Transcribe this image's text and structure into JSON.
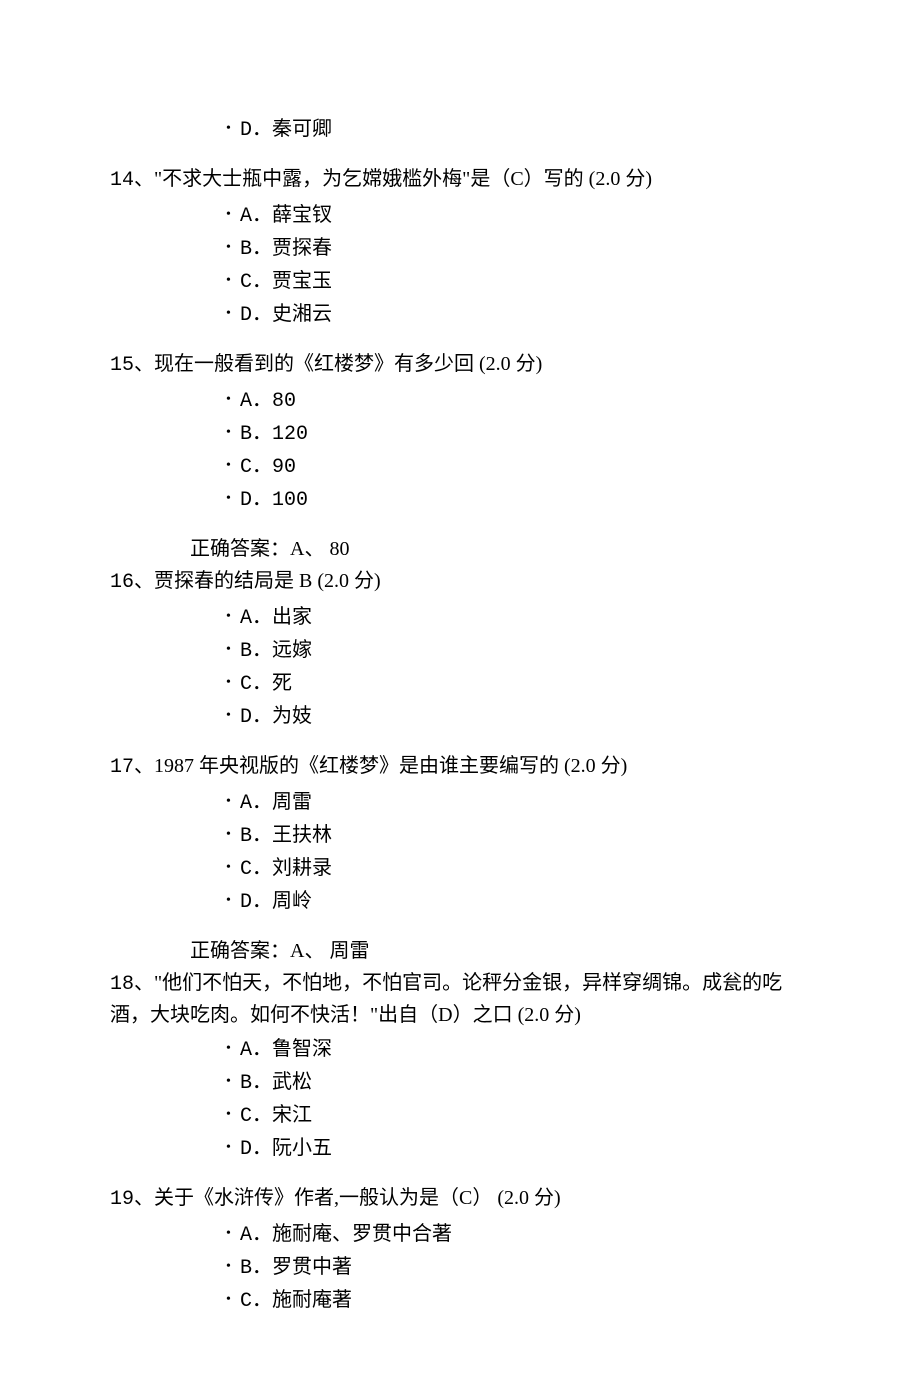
{
  "trailing_option": "D．秦可卿",
  "questions": [
    {
      "num": "14",
      "text": "、\"不求大士瓶中露，为乞嫦娥槛外梅\"是（C）写的   (2.0 分)",
      "options": [
        "A．薛宝钗",
        "B．贾探春",
        "C．贾宝玉",
        "D．史湘云"
      ],
      "answer": ""
    },
    {
      "num": "15",
      "text": "、现在一般看到的《红楼梦》有多少回   (2.0 分)",
      "options": [
        "A．80",
        "B．120",
        "C．90",
        "D．100"
      ],
      "answer": "正确答案：A、 80"
    },
    {
      "num": "16",
      "text": "、贾探春的结局是 B   (2.0 分)",
      "options": [
        "A．出家",
        "B．远嫁",
        "C．死",
        "D．为妓"
      ],
      "answer": ""
    },
    {
      "num": "17",
      "text": "、1987 年央视版的《红楼梦》是由谁主要编写的   (2.0 分)",
      "options": [
        "A．周雷",
        "B．王扶林",
        "C．刘耕录",
        "D．周岭"
      ],
      "answer": "正确答案：A、 周雷"
    },
    {
      "num": "18",
      "text": "、\"他们不怕天，不怕地，不怕官司。论秤分金银，异样穿绸锦。成瓮的吃酒，大块吃肉。如何不快活！\"出自（D）之口   (2.0 分)",
      "options": [
        "A．鲁智深",
        "B．武松",
        "C．宋江",
        "D．阮小五"
      ],
      "answer": ""
    },
    {
      "num": "19",
      "text": "、关于《水浒传》作者,一般认为是（C）   (2.0 分)",
      "options": [
        "A．施耐庵、罗贯中合著",
        "B．罗贯中著",
        "C．施耐庵著"
      ],
      "answer": ""
    }
  ]
}
